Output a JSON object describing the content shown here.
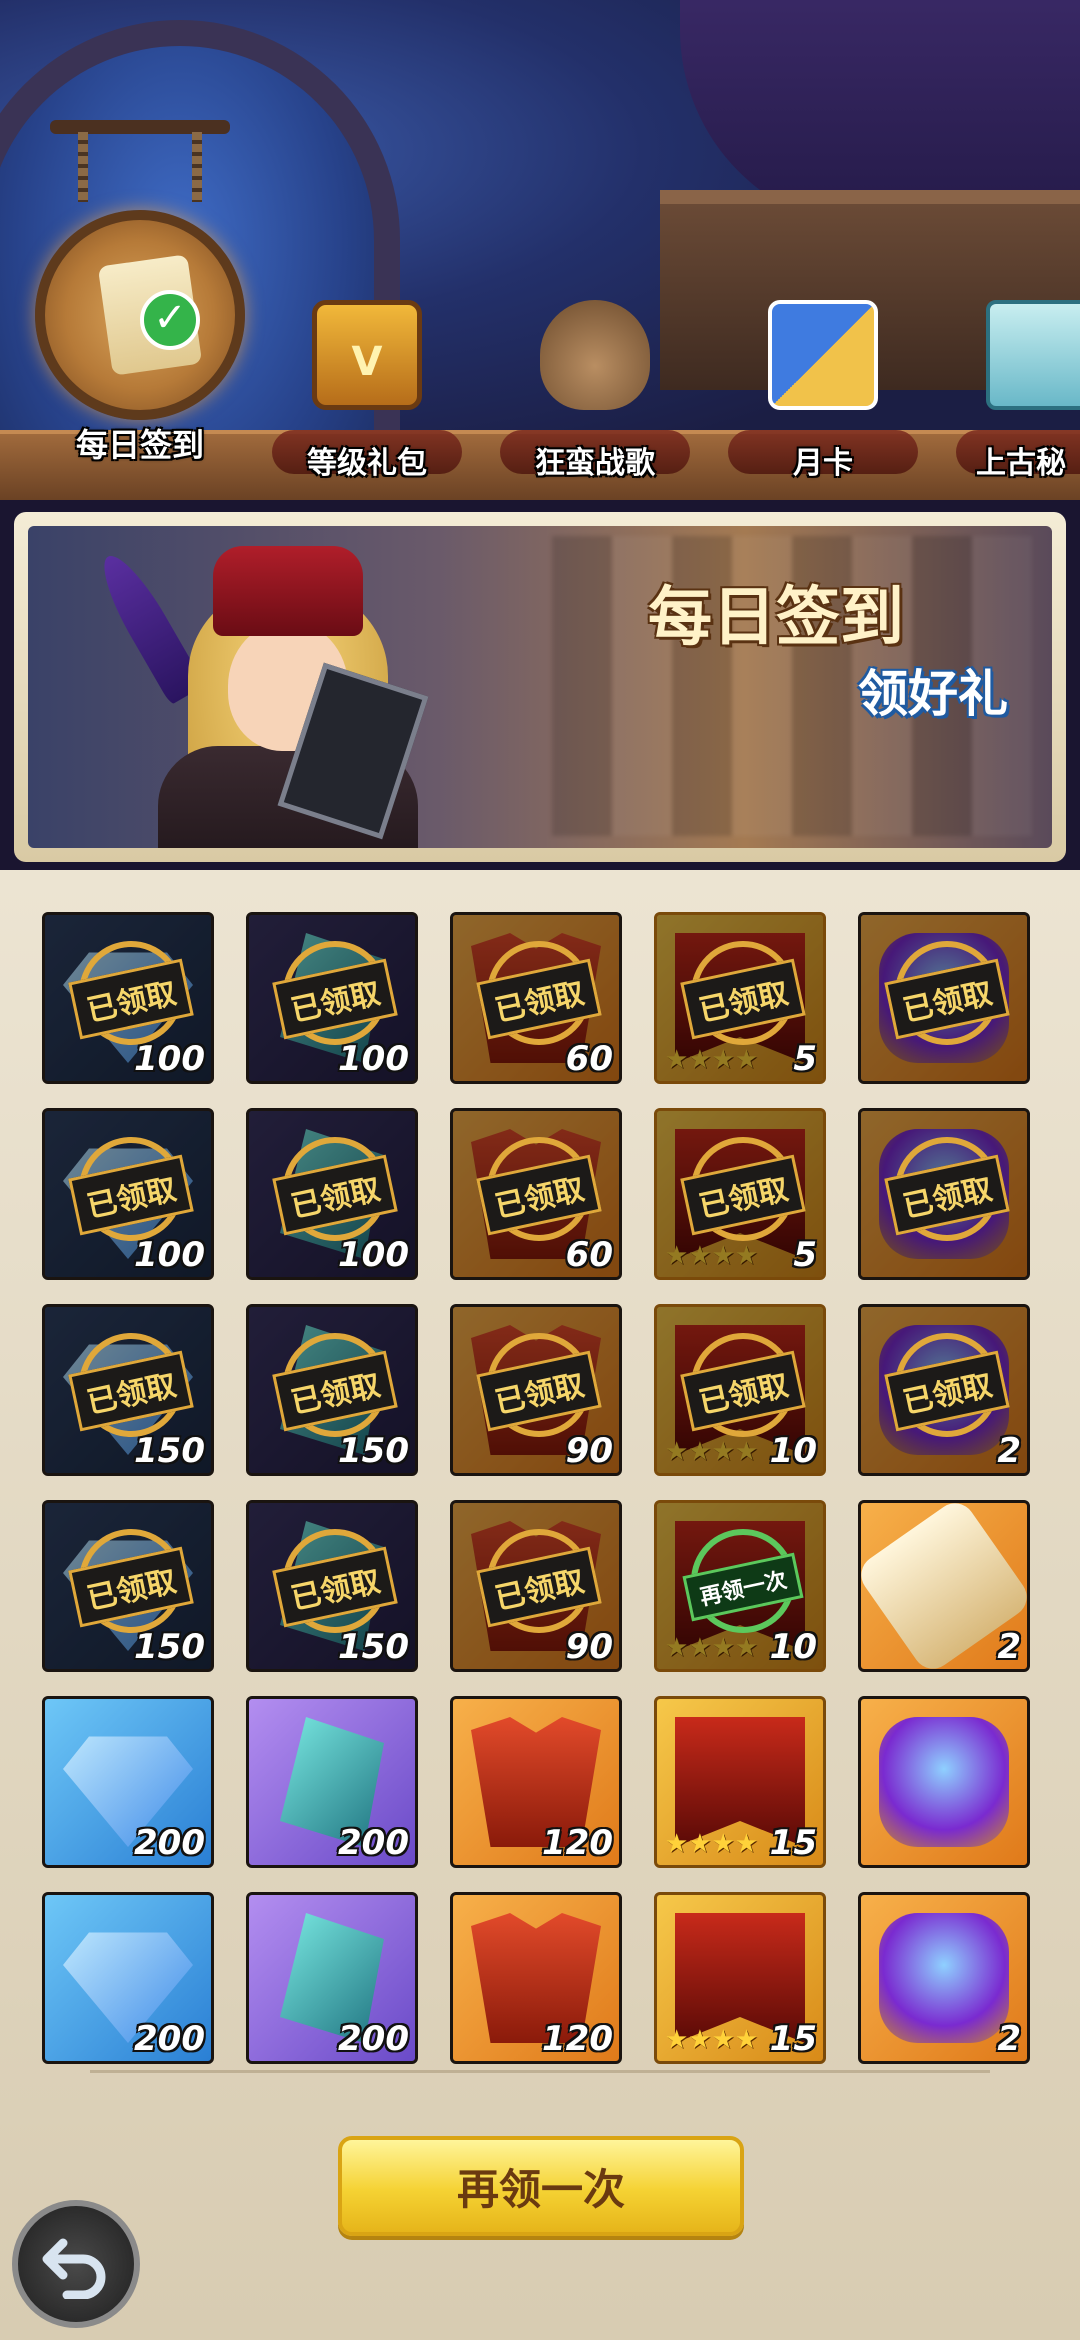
{
  "tabs": [
    {
      "label": "每日签到",
      "icon": "scroll-check-icon",
      "active": true
    },
    {
      "label": "等级礼包",
      "icon": "treasure-chest-icon"
    },
    {
      "label": "狂蛮战歌",
      "icon": "loot-bag-icon"
    },
    {
      "label": "月卡",
      "icon": "cards-icon"
    },
    {
      "label": "上古秘",
      "icon": "ancient-scroll-icon"
    }
  ],
  "banner": {
    "title": "每日签到",
    "subtitle": "领好礼"
  },
  "grid": {
    "claimed_label": "已领取",
    "again_label": "再领一次",
    "cells": [
      {
        "bg": "navy",
        "art": "diamond",
        "qty": "100",
        "state": "claimed"
      },
      {
        "bg": "purple",
        "art": "crystal",
        "qty": "100",
        "state": "claimed"
      },
      {
        "bg": "orange",
        "art": "vbadge",
        "qty": "60",
        "state": "claimed"
      },
      {
        "bg": "gold",
        "art": "banner",
        "qty": "5",
        "state": "claimed",
        "stars": 4
      },
      {
        "bg": "orange",
        "art": "gem",
        "qty": "",
        "state": "claimed"
      },
      {
        "bg": "navy",
        "art": "diamond",
        "qty": "100",
        "state": "claimed"
      },
      {
        "bg": "purple",
        "art": "crystal",
        "qty": "100",
        "state": "claimed"
      },
      {
        "bg": "orange",
        "art": "vbadge",
        "qty": "60",
        "state": "claimed"
      },
      {
        "bg": "gold",
        "art": "banner",
        "qty": "5",
        "state": "claimed",
        "stars": 4
      },
      {
        "bg": "orange",
        "art": "gem",
        "qty": "",
        "state": "claimed"
      },
      {
        "bg": "navy",
        "art": "diamond",
        "qty": "150",
        "state": "claimed"
      },
      {
        "bg": "purple",
        "art": "crystal",
        "qty": "150",
        "state": "claimed"
      },
      {
        "bg": "orange",
        "art": "vbadge",
        "qty": "90",
        "state": "claimed"
      },
      {
        "bg": "gold",
        "art": "banner",
        "qty": "10",
        "state": "claimed",
        "stars": 4
      },
      {
        "bg": "orange",
        "art": "gem",
        "qty": "2",
        "state": "claimed"
      },
      {
        "bg": "navy",
        "art": "diamond",
        "qty": "150",
        "state": "claimed"
      },
      {
        "bg": "purple",
        "art": "crystal",
        "qty": "150",
        "state": "claimed"
      },
      {
        "bg": "orange",
        "art": "vbadge",
        "qty": "90",
        "state": "claimed"
      },
      {
        "bg": "gold",
        "art": "banner",
        "qty": "10",
        "state": "again",
        "stars": 4
      },
      {
        "bg": "orange",
        "art": "scroll",
        "qty": "2",
        "state": "available"
      },
      {
        "bg": "blue",
        "art": "diamond",
        "qty": "200",
        "state": "available"
      },
      {
        "bg": "violet",
        "art": "crystal",
        "qty": "200",
        "state": "available"
      },
      {
        "bg": "orange",
        "art": "vbadge",
        "qty": "120",
        "state": "available"
      },
      {
        "bg": "gold",
        "art": "banner",
        "qty": "15",
        "state": "available",
        "stars": 4
      },
      {
        "bg": "orange",
        "art": "gem",
        "qty": "",
        "state": "available"
      },
      {
        "bg": "blue",
        "art": "diamond",
        "qty": "200",
        "state": "available"
      },
      {
        "bg": "violet",
        "art": "crystal",
        "qty": "200",
        "state": "available"
      },
      {
        "bg": "orange",
        "art": "vbadge",
        "qty": "120",
        "state": "available"
      },
      {
        "bg": "gold",
        "art": "banner",
        "qty": "15",
        "state": "available",
        "stars": 4
      },
      {
        "bg": "orange",
        "art": "gem",
        "qty": "2",
        "state": "available"
      }
    ]
  },
  "buttons": {
    "again": "再领一次",
    "back_icon": "undo-arrow-icon"
  },
  "colors": {
    "stamp_gold": "#e0a83a",
    "button_yellow": "#f5d233",
    "again_green": "#5cc85c"
  }
}
